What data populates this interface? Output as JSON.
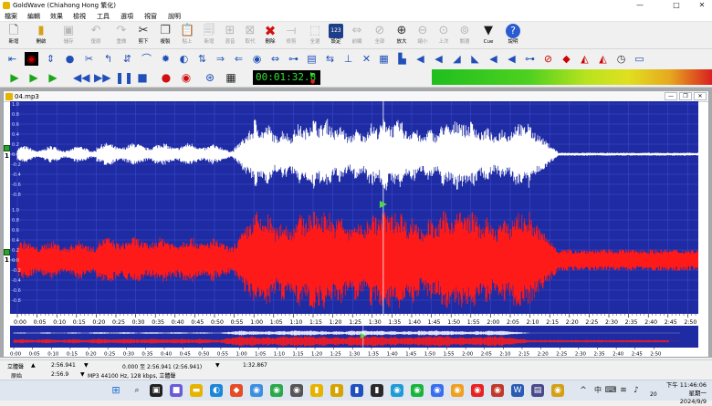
{
  "window": {
    "title": "GoldWave (Chiahong Hong 繁化)",
    "minimize": "—",
    "maximize": "□",
    "close": "✕"
  },
  "menu": [
    "檔案",
    "編輯",
    "效果",
    "檢視",
    "工具",
    "選項",
    "視窗",
    "說明"
  ],
  "toolbar": [
    {
      "label": "新增",
      "icon": "new-file-icon",
      "enabled": true
    },
    {
      "label": "開啟",
      "icon": "open-folder-icon",
      "enabled": true
    },
    {
      "label": "儲存",
      "icon": "save-icon",
      "enabled": false
    },
    {
      "label": "復原",
      "icon": "undo-icon",
      "enabled": false
    },
    {
      "label": "重做",
      "icon": "redo-icon",
      "enabled": false
    },
    {
      "label": "剪下",
      "icon": "cut-icon",
      "enabled": true
    },
    {
      "label": "複製",
      "icon": "copy-icon",
      "enabled": true
    },
    {
      "label": "貼上",
      "icon": "paste-icon",
      "enabled": false
    },
    {
      "label": "新增",
      "icon": "paste-new-icon",
      "enabled": false
    },
    {
      "label": "混音",
      "icon": "mix-icon",
      "enabled": false
    },
    {
      "label": "取代",
      "icon": "replace-icon",
      "enabled": false
    },
    {
      "label": "刪除",
      "icon": "delete-icon",
      "enabled": true
    },
    {
      "label": "修剪",
      "icon": "trim-icon",
      "enabled": false
    },
    {
      "label": "全選",
      "icon": "select-all-icon",
      "enabled": false
    },
    {
      "label": "設定",
      "icon": "set-selection-icon",
      "enabled": true
    },
    {
      "label": "前顯",
      "icon": "select-view-icon",
      "enabled": false
    },
    {
      "label": "全部",
      "icon": "zoom-all-icon",
      "enabled": false
    },
    {
      "label": "放大",
      "icon": "zoom-in-icon",
      "enabled": true
    },
    {
      "label": "縮小",
      "icon": "zoom-out-icon",
      "enabled": false
    },
    {
      "label": "上次",
      "icon": "zoom-previous-icon",
      "enabled": false
    },
    {
      "label": "關選",
      "icon": "zoom-selection-icon",
      "enabled": false
    },
    {
      "label": "Cue",
      "icon": "cue-icon",
      "enabled": true
    },
    {
      "label": "說明",
      "icon": "help-icon",
      "enabled": true
    }
  ],
  "transport": {
    "time": "00:01:32.8",
    "set_badge": "123"
  },
  "document": {
    "title": "04.mp3",
    "minimize": "—",
    "restore": "❐",
    "close": "✕"
  },
  "axis": {
    "amplitude_ticks": [
      "1.0",
      "0.8",
      "0.6",
      "0.4",
      "0.2",
      "0.0",
      "-0.2",
      "-0.4",
      "-0.6",
      "-0.8"
    ],
    "time_ticks": [
      "0:00",
      "0:05",
      "0:10",
      "0:15",
      "0:20",
      "0:25",
      "0:30",
      "0:35",
      "0:40",
      "0:45",
      "0:50",
      "0:55",
      "1:00",
      "1:05",
      "1:10",
      "1:15",
      "1:20",
      "1:25",
      "1:30",
      "1:35",
      "1:40",
      "1:45",
      "1:50",
      "1:55",
      "2:00",
      "2:05",
      "2:10",
      "2:15",
      "2:20",
      "2:25",
      "2:30",
      "2:35",
      "2:40",
      "2:45",
      "2:50"
    ],
    "duration_seconds": 176.941,
    "playhead_seconds": 92.8
  },
  "channels": [
    {
      "number": "1",
      "color": "#ffffff"
    },
    {
      "number": "1",
      "color": "#ff1a1a"
    }
  ],
  "colors": {
    "wave_bg": "#1e2ba3",
    "grid": "#3e4ed2",
    "left_channel": "#ffffff",
    "right_channel": "#ff1a1a",
    "center_line": "#c8c8c8"
  },
  "status": {
    "channel_mode": "立體聲",
    "length": "2:56.941",
    "selection": "0.000 至 2:56.941 (2:56.941)",
    "position": "1:32.867",
    "original_label": "原始",
    "original_length": "2:56.9",
    "format": "MP3 44100 Hz, 128 kbps, 立體聲"
  },
  "taskbar": {
    "tray_lang": "中",
    "time": "下午 11:46:06",
    "date_line": "星期一",
    "date": "2024/9/9",
    "day": "20"
  }
}
